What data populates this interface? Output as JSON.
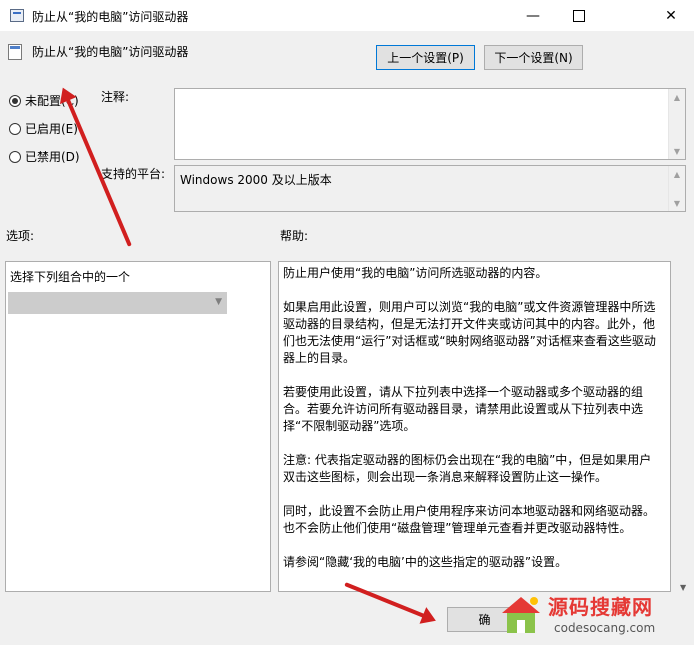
{
  "window": {
    "title": "防止从“我的电脑”访问驱动器",
    "minimize": "—",
    "close": "✕"
  },
  "setting": {
    "title": "防止从“我的电脑”访问驱动器"
  },
  "nav": {
    "prev": "上一个设置(P)",
    "next": "下一个设置(N)"
  },
  "radios": [
    {
      "label": "未配置(C)",
      "checked": true
    },
    {
      "label": "已启用(E)",
      "checked": false
    },
    {
      "label": "已禁用(D)",
      "checked": false
    }
  ],
  "labels": {
    "comment": "注释:",
    "platform": "支持的平台:",
    "options": "选项:",
    "help": "帮助:"
  },
  "comment_value": "",
  "platform_value": "Windows 2000 及以上版本",
  "options": {
    "combo_label": "选择下列组合中的一个",
    "combo_value": ""
  },
  "help": {
    "paragraphs": [
      "防止用户使用“我的电脑”访问所选驱动器的内容。",
      "如果启用此设置，则用户可以浏览“我的电脑”或文件资源管理器中所选驱动器的目录结构，但是无法打开文件夹或访问其中的内容。此外，他们也无法使用“运行”对话框或“映射网络驱动器”对话框来查看这些驱动器上的目录。",
      "若要使用此设置，请从下拉列表中选择一个驱动器或多个驱动器的组合。若要允许访问所有驱动器目录，请禁用此设置或从下拉列表中选择“不限制驱动器”选项。",
      "注意: 代表指定驱动器的图标仍会出现在“我的电脑”中，但是如果用户双击这些图标，则会出现一条消息来解释设置防止这一操作。",
      " 同时，此设置不会防止用户使用程序来访问本地驱动器和网络驱动器。也不会防止他们使用“磁盘管理”管理单元查看并更改驱动器特性。",
      "请参阅“隐藏‘我的电脑’中的这些指定的驱动器”设置。"
    ]
  },
  "buttons": {
    "ok": "确"
  },
  "watermark": {
    "brand_cn": "源码搜藏网",
    "brand_en": "codesocang.com"
  },
  "annotation_color": "#d11f1f"
}
